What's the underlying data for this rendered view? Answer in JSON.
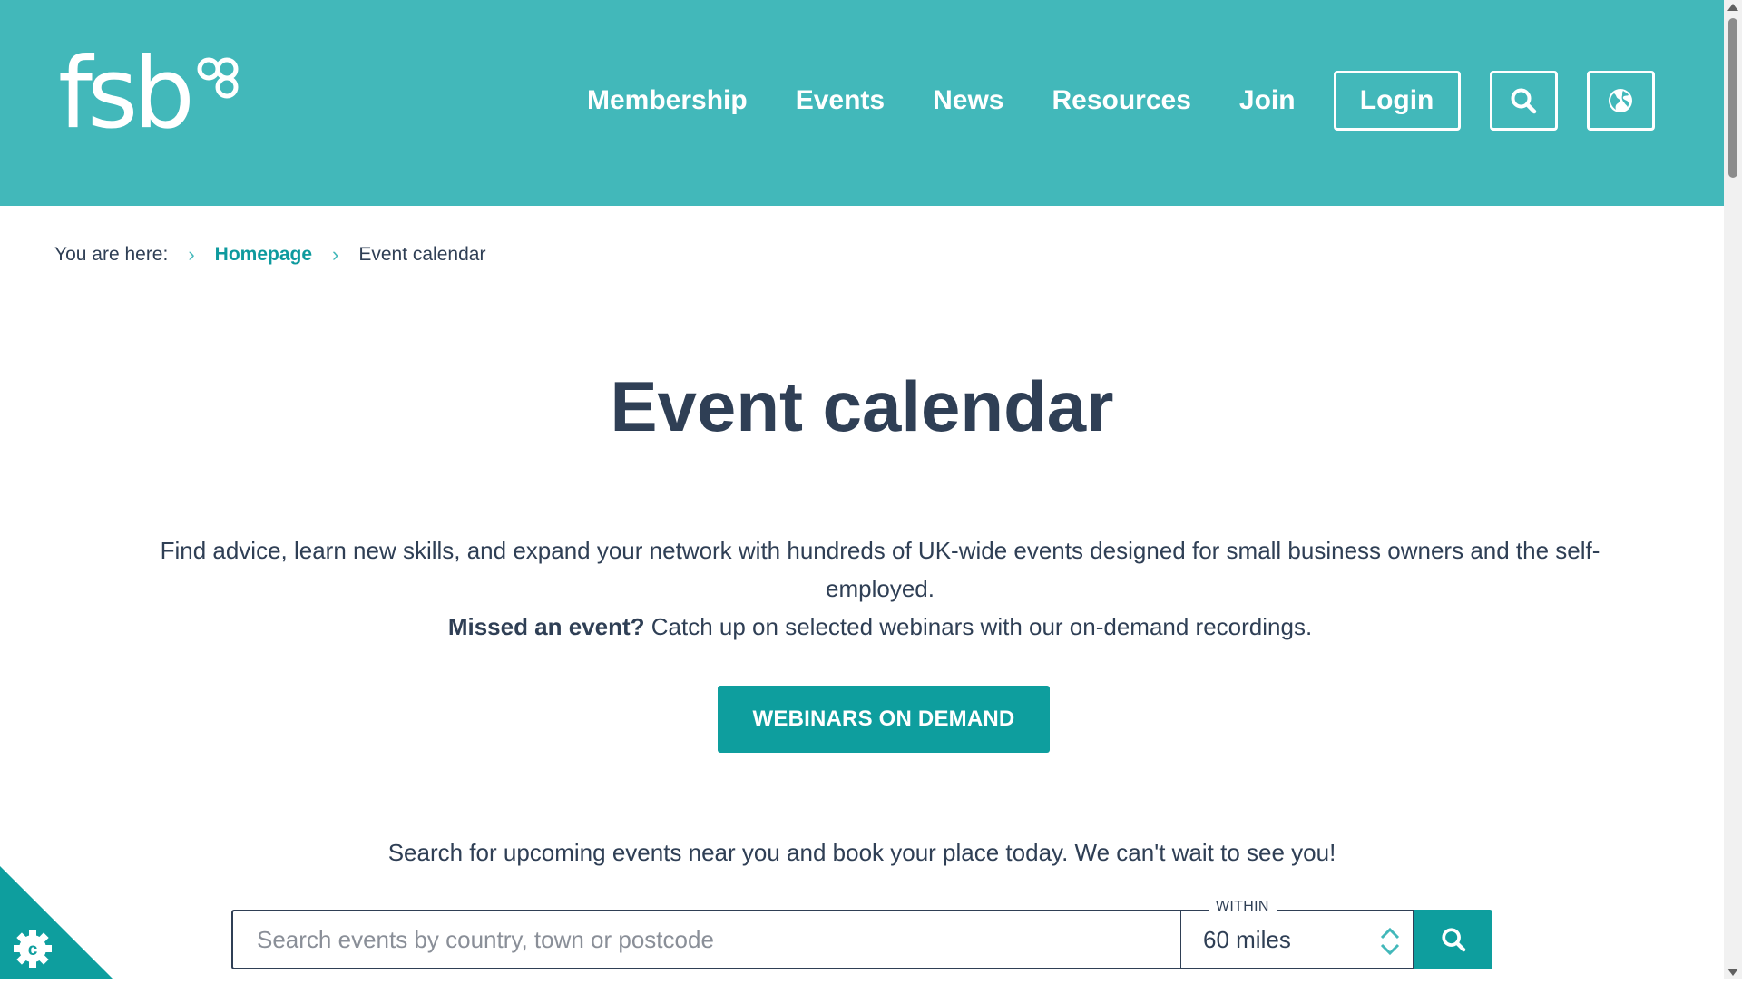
{
  "header": {
    "logo_text": "fsb",
    "nav": [
      "Membership",
      "Events",
      "News",
      "Resources",
      "Join"
    ],
    "login_label": "Login"
  },
  "breadcrumb": {
    "prefix": "You are here:",
    "home": "Homepage",
    "current": "Event calendar"
  },
  "main": {
    "title": "Event calendar",
    "intro_line1": "Find advice, learn new skills, and expand your network with hundreds of UK-wide events designed for small business owners and the self-employed.",
    "missed_bold": "Missed an event?",
    "missed_rest": " Catch up on selected webinars with our on-demand recordings.",
    "cta_label": "WEBINARS ON DEMAND",
    "search_note": "Search for upcoming events near you and book your place today. We can't wait to see you!"
  },
  "search": {
    "placeholder": "Search events by country, town or postcode",
    "value": "",
    "within_label": "WITHIN",
    "within_value": "60 miles"
  },
  "colors": {
    "brand_teal": "#42b8ba",
    "button_teal": "#0e9e9e",
    "text_dark": "#2f3f55"
  },
  "icons": [
    "search-icon",
    "globe-icon",
    "chevron-right-icon",
    "up-down-arrows-icon",
    "cookie-settings-icon"
  ]
}
